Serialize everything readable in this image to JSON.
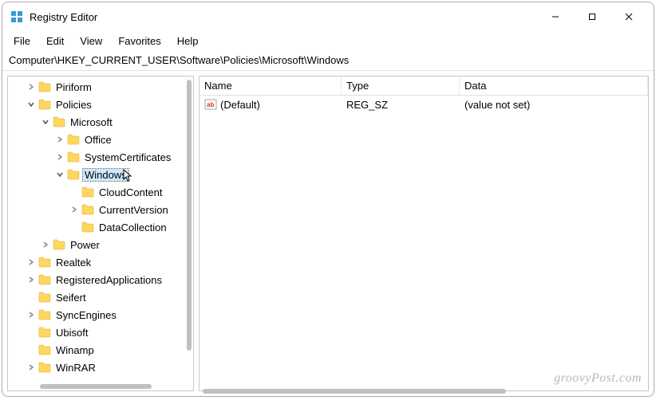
{
  "window": {
    "title": "Registry Editor"
  },
  "menubar": {
    "file": "File",
    "edit": "Edit",
    "view": "View",
    "favorites": "Favorites",
    "help": "Help"
  },
  "addressbar": {
    "path": "Computer\\HKEY_CURRENT_USER\\Software\\Policies\\Microsoft\\Windows"
  },
  "tree": {
    "items": [
      {
        "label": "Piriform",
        "indent": 1,
        "expander": "closed"
      },
      {
        "label": "Policies",
        "indent": 1,
        "expander": "open"
      },
      {
        "label": "Microsoft",
        "indent": 2,
        "expander": "open"
      },
      {
        "label": "Office",
        "indent": 3,
        "expander": "closed"
      },
      {
        "label": "SystemCertificates",
        "indent": 3,
        "expander": "closed"
      },
      {
        "label": "Windows",
        "indent": 3,
        "expander": "open",
        "selected": true,
        "cursor": true
      },
      {
        "label": "CloudContent",
        "indent": 4,
        "expander": "none"
      },
      {
        "label": "CurrentVersion",
        "indent": 4,
        "expander": "closed"
      },
      {
        "label": "DataCollection",
        "indent": 4,
        "expander": "none"
      },
      {
        "label": "Power",
        "indent": 2,
        "expander": "closed"
      },
      {
        "label": "Realtek",
        "indent": 1,
        "expander": "closed"
      },
      {
        "label": "RegisteredApplications",
        "indent": 1,
        "expander": "closed"
      },
      {
        "label": "Seifert",
        "indent": 1,
        "expander": "none"
      },
      {
        "label": "SyncEngines",
        "indent": 1,
        "expander": "closed"
      },
      {
        "label": "Ubisoft",
        "indent": 1,
        "expander": "none"
      },
      {
        "label": "Winamp",
        "indent": 1,
        "expander": "none"
      },
      {
        "label": "WinRAR",
        "indent": 1,
        "expander": "closed"
      }
    ]
  },
  "list": {
    "headers": {
      "name": "Name",
      "type": "Type",
      "data": "Data"
    },
    "rows": [
      {
        "name": "(Default)",
        "type": "REG_SZ",
        "data": "(value not set)"
      }
    ]
  },
  "watermark": "groovyPost.com"
}
